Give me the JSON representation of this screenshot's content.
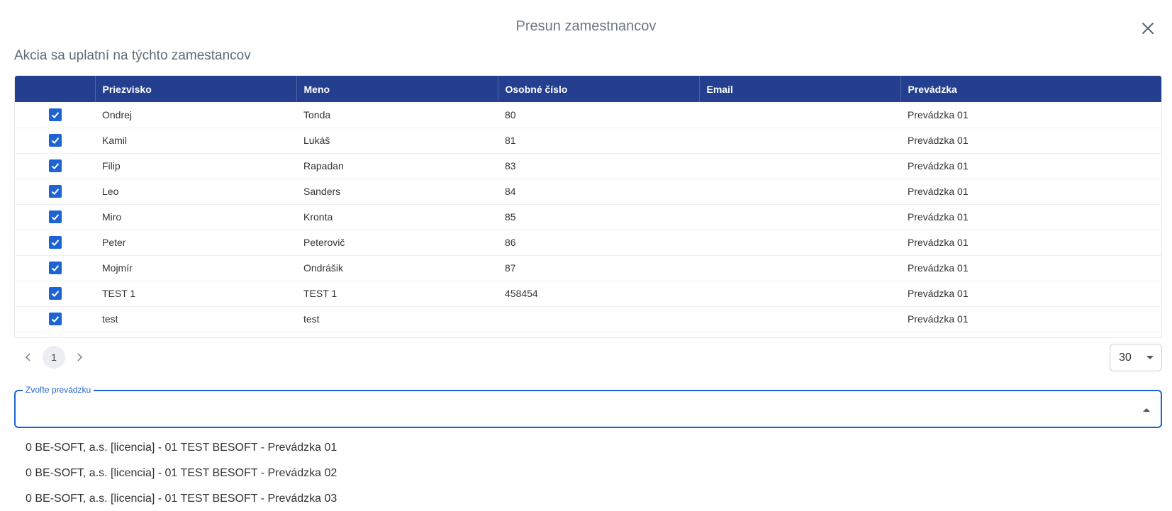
{
  "modal": {
    "title": "Presun zamestnancov",
    "subtitle": "Akcia sa uplatní na týchto zamestancov"
  },
  "table": {
    "columns": [
      "",
      "Priezvisko",
      "Meno",
      "Osobné číslo",
      "Email",
      "Prevádzka"
    ],
    "rows": [
      {
        "checked": true,
        "priezvisko": "Ondrej",
        "meno": "Tonda",
        "osobne_cislo": "80",
        "email": "",
        "prevadzka": "Prevádzka 01"
      },
      {
        "checked": true,
        "priezvisko": "Kamil",
        "meno": "Lukáš",
        "osobne_cislo": "81",
        "email": "",
        "prevadzka": "Prevádzka 01"
      },
      {
        "checked": true,
        "priezvisko": "Filip",
        "meno": "Rapadan",
        "osobne_cislo": "83",
        "email": "",
        "prevadzka": "Prevádzka 01"
      },
      {
        "checked": true,
        "priezvisko": "Leo",
        "meno": "Sanders",
        "osobne_cislo": "84",
        "email": "",
        "prevadzka": "Prevádzka 01"
      },
      {
        "checked": true,
        "priezvisko": "Miro",
        "meno": "Kronta",
        "osobne_cislo": "85",
        "email": "",
        "prevadzka": "Prevádzka 01"
      },
      {
        "checked": true,
        "priezvisko": "Peter",
        "meno": "Peterovič",
        "osobne_cislo": "86",
        "email": "",
        "prevadzka": "Prevádzka 01"
      },
      {
        "checked": true,
        "priezvisko": "Mojmír",
        "meno": "Ondrášik",
        "osobne_cislo": "87",
        "email": "",
        "prevadzka": "Prevádzka 01"
      },
      {
        "checked": true,
        "priezvisko": "TEST 1",
        "meno": "TEST 1",
        "osobne_cislo": "458454",
        "email": "",
        "prevadzka": "Prevádzka 01"
      },
      {
        "checked": true,
        "priezvisko": "test",
        "meno": "test",
        "osobne_cislo": "",
        "email": "",
        "prevadzka": "Prevádzka 01"
      }
    ]
  },
  "pagination": {
    "current_page": "1",
    "rows_per_page": "30"
  },
  "prevadzka_field": {
    "label": "Zvoľte prevádzku",
    "value": "",
    "options": [
      "0 BE-SOFT, a.s. [licencia] - 01 TEST BESOFT - Prevádzka 01",
      "0 BE-SOFT, a.s. [licencia] - 01 TEST BESOFT - Prevádzka 02",
      "0 BE-SOFT, a.s. [licencia] - 01 TEST BESOFT - Prevádzka 03"
    ]
  },
  "colors": {
    "header_bg": "#243f8f",
    "accent": "#1e63d6",
    "title_text": "#6b7785"
  },
  "icons": {
    "close": "close-icon",
    "checkbox": "checkbox-checked-icon",
    "prev": "chevron-left-icon",
    "next": "chevron-right-icon",
    "dropdown": "caret-down-icon",
    "collapse": "caret-up-icon"
  }
}
